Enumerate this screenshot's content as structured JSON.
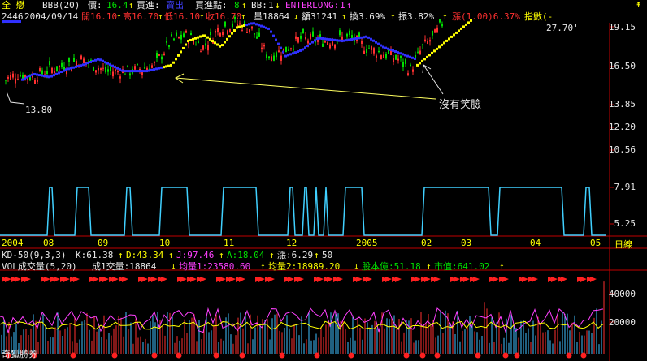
{
  "header": {
    "stock_name": "全 懋",
    "indicator": "BBB(20)",
    "price_label": "價:",
    "price": "16.4",
    "buy_label": "買進:",
    "buy_value": "賣出",
    "buy_point_label": "買進點:",
    "buy_point": "8",
    "bb_label": "BB:",
    "bb_value": "1",
    "enterlong_label": "ENTERLONG:",
    "enterlong": "1",
    "up_arrow_icon": "up-arrow-icon"
  },
  "quote": {
    "code": "2446",
    "date": "2004/09/14",
    "open": "開16.10",
    "high": "高16.70",
    "low": "低16.10",
    "close": "收16.70",
    "volume": "量18864",
    "amount": "額31241",
    "turnover": "換3.69%",
    "amplitude": "振3.82%",
    "change": "漲(1.00)6.37%",
    "index_label": "指數(-"
  },
  "price_axis": [
    "19.15",
    "16.50",
    "13.85",
    "12.20",
    "10.56",
    "7.91",
    "5.25"
  ],
  "price_annotations": {
    "high": "27.70'",
    "low": "13.80",
    "comment": "沒有笑臉"
  },
  "time_axis": {
    "labels": [
      "2004",
      "08",
      "09",
      "10",
      "11",
      "12",
      "2005",
      "02",
      "03",
      "04",
      "05"
    ],
    "period": "日線"
  },
  "kd": {
    "label": "KD-50(9,3,3)",
    "k": "K:61.38",
    "d": "D:43.34",
    "j": "J:97.46",
    "a": "A:18.04",
    "rise": "漲:6.29",
    "threshold": "50"
  },
  "vol": {
    "label": "VOL成交量(5,20)",
    "volume": "成1交量:18864",
    "ma1": "均量1:23580.60",
    "ma2": "均量2:18989.20",
    "equity": "股本億:51.18",
    "market_value": "市值:641.02",
    "axis": [
      "40000",
      "20000"
    ]
  },
  "footer": {
    "brand": "奇狐勝券"
  },
  "colors": {
    "background": "#000000",
    "up": "#ff3030",
    "down": "#00e000",
    "accent_yellow": "#ffff00",
    "signal_cyan": "#40d0ff",
    "ma_blue": "#3030ff"
  }
}
